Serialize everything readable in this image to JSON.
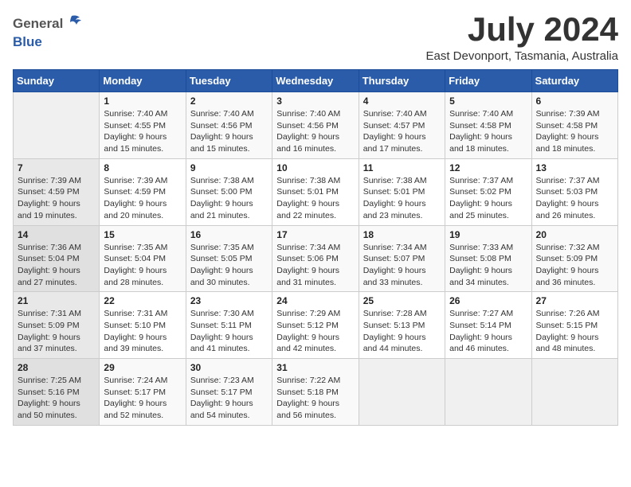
{
  "header": {
    "logo_general": "General",
    "logo_blue": "Blue",
    "month_title": "July 2024",
    "location": "East Devonport, Tasmania, Australia"
  },
  "calendar": {
    "days_of_week": [
      "Sunday",
      "Monday",
      "Tuesday",
      "Wednesday",
      "Thursday",
      "Friday",
      "Saturday"
    ],
    "weeks": [
      [
        {
          "day": "",
          "info": ""
        },
        {
          "day": "1",
          "info": "Sunrise: 7:40 AM\nSunset: 4:55 PM\nDaylight: 9 hours\nand 15 minutes."
        },
        {
          "day": "2",
          "info": "Sunrise: 7:40 AM\nSunset: 4:56 PM\nDaylight: 9 hours\nand 15 minutes."
        },
        {
          "day": "3",
          "info": "Sunrise: 7:40 AM\nSunset: 4:56 PM\nDaylight: 9 hours\nand 16 minutes."
        },
        {
          "day": "4",
          "info": "Sunrise: 7:40 AM\nSunset: 4:57 PM\nDaylight: 9 hours\nand 17 minutes."
        },
        {
          "day": "5",
          "info": "Sunrise: 7:40 AM\nSunset: 4:58 PM\nDaylight: 9 hours\nand 18 minutes."
        },
        {
          "day": "6",
          "info": "Sunrise: 7:39 AM\nSunset: 4:58 PM\nDaylight: 9 hours\nand 18 minutes."
        }
      ],
      [
        {
          "day": "7",
          "info": "Sunrise: 7:39 AM\nSunset: 4:59 PM\nDaylight: 9 hours\nand 19 minutes."
        },
        {
          "day": "8",
          "info": "Sunrise: 7:39 AM\nSunset: 4:59 PM\nDaylight: 9 hours\nand 20 minutes."
        },
        {
          "day": "9",
          "info": "Sunrise: 7:38 AM\nSunset: 5:00 PM\nDaylight: 9 hours\nand 21 minutes."
        },
        {
          "day": "10",
          "info": "Sunrise: 7:38 AM\nSunset: 5:01 PM\nDaylight: 9 hours\nand 22 minutes."
        },
        {
          "day": "11",
          "info": "Sunrise: 7:38 AM\nSunset: 5:01 PM\nDaylight: 9 hours\nand 23 minutes."
        },
        {
          "day": "12",
          "info": "Sunrise: 7:37 AM\nSunset: 5:02 PM\nDaylight: 9 hours\nand 25 minutes."
        },
        {
          "day": "13",
          "info": "Sunrise: 7:37 AM\nSunset: 5:03 PM\nDaylight: 9 hours\nand 26 minutes."
        }
      ],
      [
        {
          "day": "14",
          "info": "Sunrise: 7:36 AM\nSunset: 5:04 PM\nDaylight: 9 hours\nand 27 minutes."
        },
        {
          "day": "15",
          "info": "Sunrise: 7:35 AM\nSunset: 5:04 PM\nDaylight: 9 hours\nand 28 minutes."
        },
        {
          "day": "16",
          "info": "Sunrise: 7:35 AM\nSunset: 5:05 PM\nDaylight: 9 hours\nand 30 minutes."
        },
        {
          "day": "17",
          "info": "Sunrise: 7:34 AM\nSunset: 5:06 PM\nDaylight: 9 hours\nand 31 minutes."
        },
        {
          "day": "18",
          "info": "Sunrise: 7:34 AM\nSunset: 5:07 PM\nDaylight: 9 hours\nand 33 minutes."
        },
        {
          "day": "19",
          "info": "Sunrise: 7:33 AM\nSunset: 5:08 PM\nDaylight: 9 hours\nand 34 minutes."
        },
        {
          "day": "20",
          "info": "Sunrise: 7:32 AM\nSunset: 5:09 PM\nDaylight: 9 hours\nand 36 minutes."
        }
      ],
      [
        {
          "day": "21",
          "info": "Sunrise: 7:31 AM\nSunset: 5:09 PM\nDaylight: 9 hours\nand 37 minutes."
        },
        {
          "day": "22",
          "info": "Sunrise: 7:31 AM\nSunset: 5:10 PM\nDaylight: 9 hours\nand 39 minutes."
        },
        {
          "day": "23",
          "info": "Sunrise: 7:30 AM\nSunset: 5:11 PM\nDaylight: 9 hours\nand 41 minutes."
        },
        {
          "day": "24",
          "info": "Sunrise: 7:29 AM\nSunset: 5:12 PM\nDaylight: 9 hours\nand 42 minutes."
        },
        {
          "day": "25",
          "info": "Sunrise: 7:28 AM\nSunset: 5:13 PM\nDaylight: 9 hours\nand 44 minutes."
        },
        {
          "day": "26",
          "info": "Sunrise: 7:27 AM\nSunset: 5:14 PM\nDaylight: 9 hours\nand 46 minutes."
        },
        {
          "day": "27",
          "info": "Sunrise: 7:26 AM\nSunset: 5:15 PM\nDaylight: 9 hours\nand 48 minutes."
        }
      ],
      [
        {
          "day": "28",
          "info": "Sunrise: 7:25 AM\nSunset: 5:16 PM\nDaylight: 9 hours\nand 50 minutes."
        },
        {
          "day": "29",
          "info": "Sunrise: 7:24 AM\nSunset: 5:17 PM\nDaylight: 9 hours\nand 52 minutes."
        },
        {
          "day": "30",
          "info": "Sunrise: 7:23 AM\nSunset: 5:17 PM\nDaylight: 9 hours\nand 54 minutes."
        },
        {
          "day": "31",
          "info": "Sunrise: 7:22 AM\nSunset: 5:18 PM\nDaylight: 9 hours\nand 56 minutes."
        },
        {
          "day": "",
          "info": ""
        },
        {
          "day": "",
          "info": ""
        },
        {
          "day": "",
          "info": ""
        }
      ]
    ]
  }
}
